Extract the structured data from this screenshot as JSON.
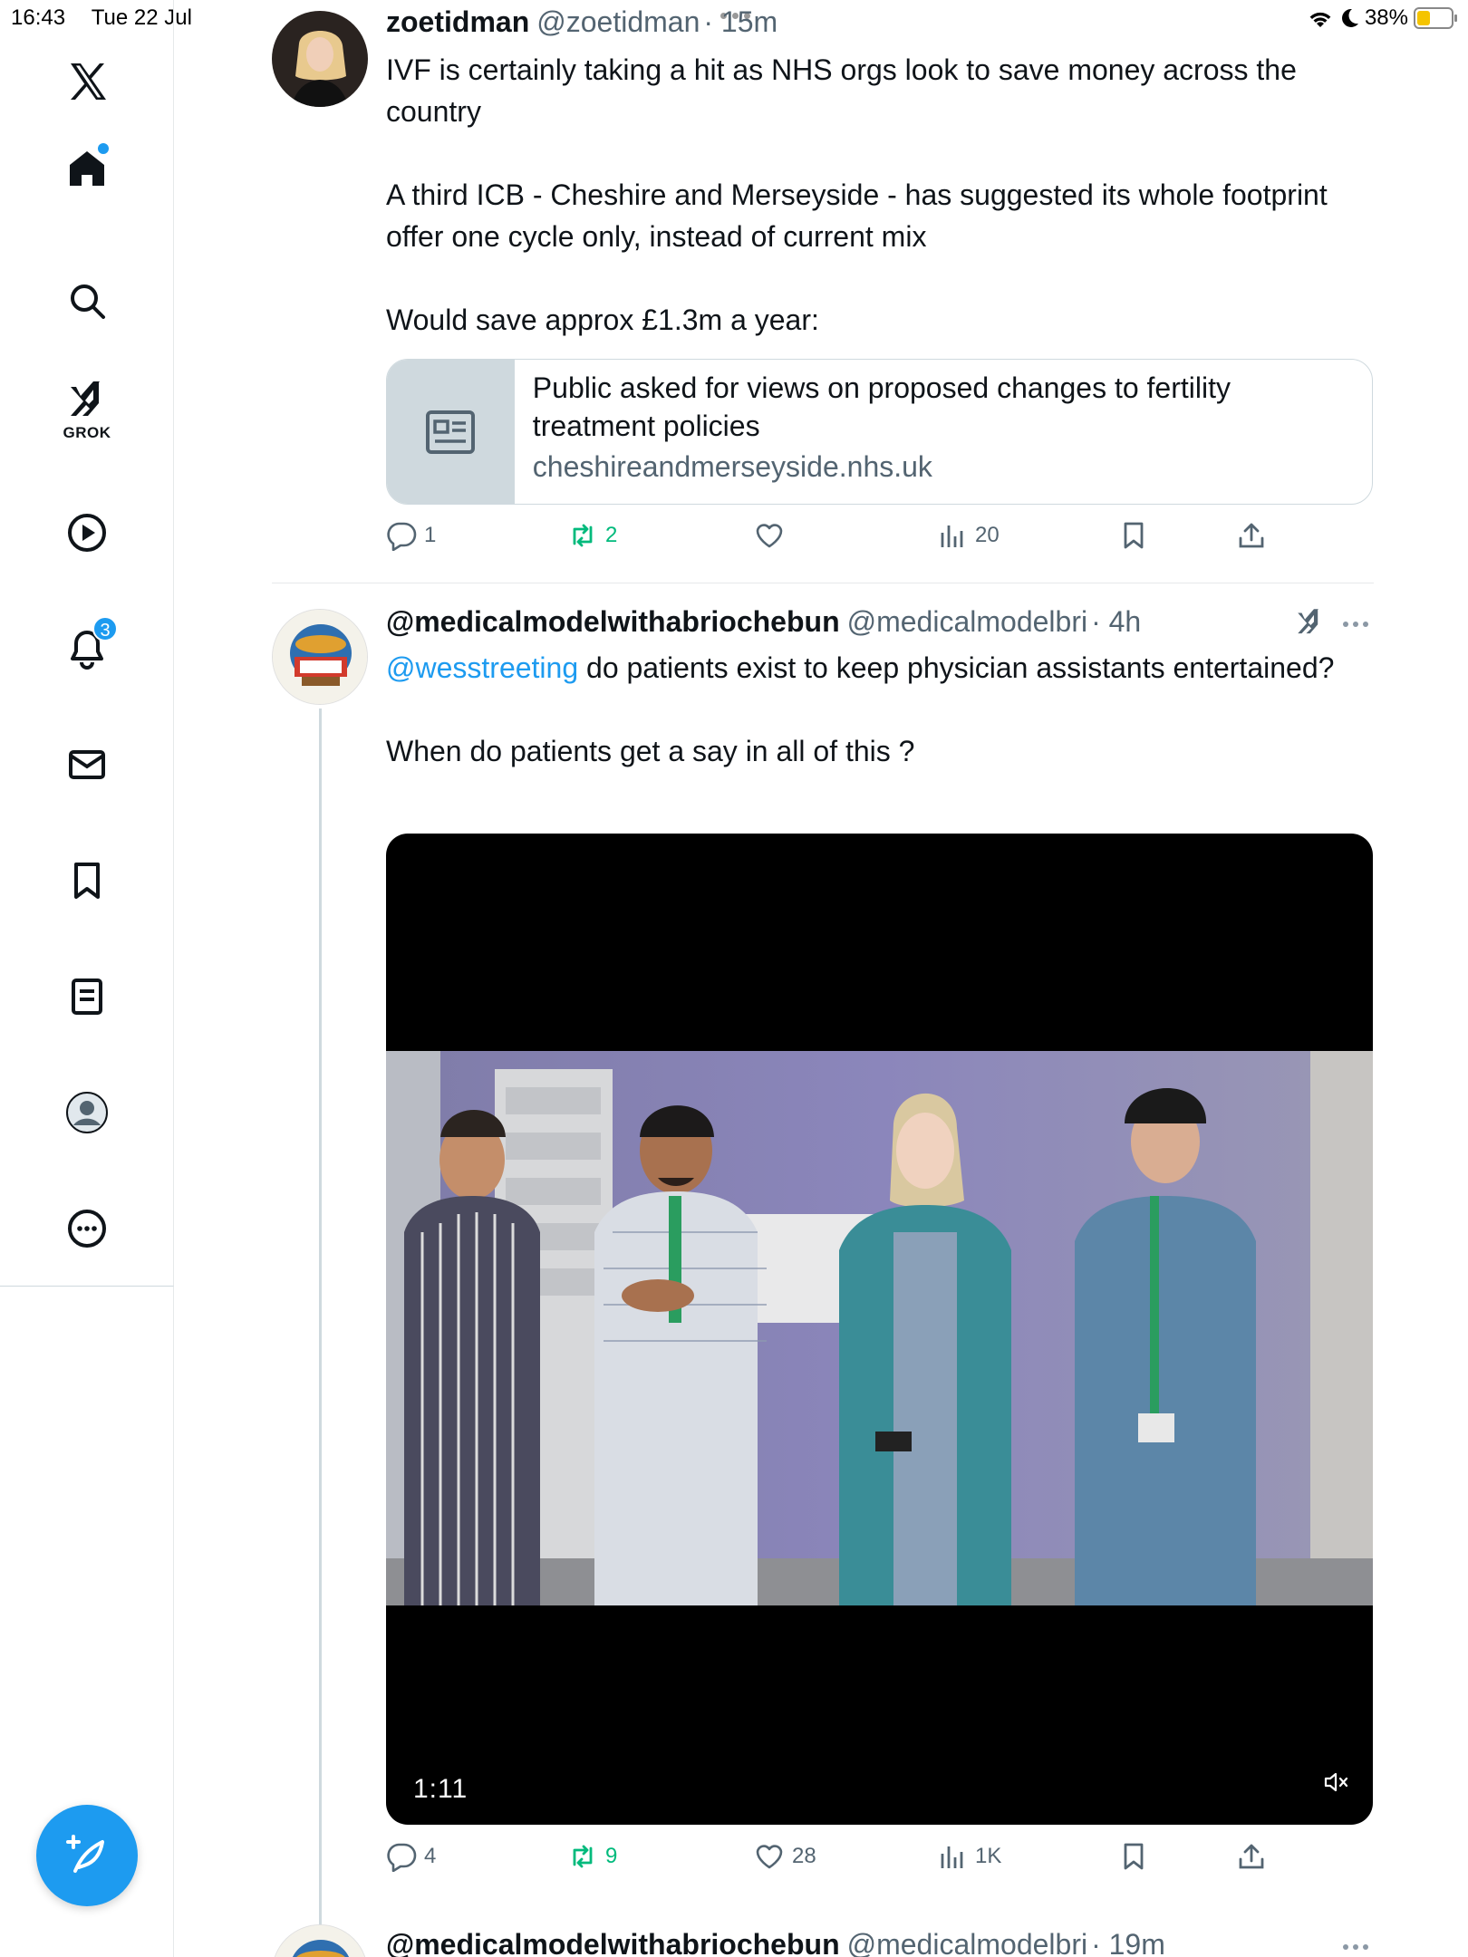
{
  "status_bar": {
    "time": "16:43",
    "date": "Tue 22 Jul",
    "battery": "38%",
    "battery_level": 0.38
  },
  "sidebar": {
    "grok_label": "GROK",
    "notifications_count": "3",
    "items": [
      "x-logo-icon",
      "home-icon",
      "search-icon",
      "grok-icon",
      "video-icon",
      "notifications-icon",
      "messages-icon",
      "bookmarks-icon",
      "lists-icon",
      "profile-icon",
      "more-icon"
    ]
  },
  "tweets": [
    {
      "name": "zoetidman",
      "handle": "@zoetidman",
      "time": "· 15m",
      "body": [
        "IVF is certainly taking a hit as NHS orgs look to save money across the country",
        "A third ICB - Cheshire and Merseyside - has suggested its whole footprint offer one cycle only, instead of current mix",
        "Would save approx £1.3m a year:"
      ],
      "card": {
        "title": "Public asked for views on proposed changes to fertility treatment policies",
        "domain": "cheshireandmerseyside.nhs.uk"
      },
      "replies": "1",
      "reposts": "2",
      "likes": "",
      "views": "20"
    },
    {
      "name": "@medicalmodelwithabriochebun",
      "handle": "@medicalmodelbri",
      "time": "· 4h",
      "mention": "@wesstreeting",
      "body_first": " do patients exist to keep physician assistants entertained?",
      "body_second": "When do patients get a say in all of this ?",
      "video_duration": "1:11",
      "replies": "4",
      "reposts": "9",
      "likes": "28",
      "views": "1K"
    },
    {
      "name": "@medicalmodelwithabriochebun",
      "handle": "@medicalmodelbri",
      "time": "· 19m"
    }
  ],
  "colors": {
    "accent": "#1d9bf0",
    "repost": "#00ba7c",
    "muted": "#536471",
    "battery": "#f5c400"
  }
}
